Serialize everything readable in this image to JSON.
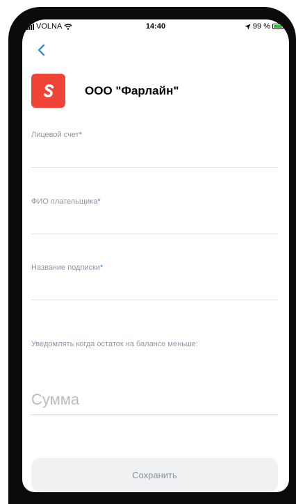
{
  "status_bar": {
    "carrier": "VOLNA",
    "time": "14:40",
    "battery_percent": "99 %",
    "battery_level": 0.99
  },
  "header": {
    "company_name": "ООО \"Фарлайн\"",
    "logo_color": "#f04438"
  },
  "form": {
    "account": {
      "label": "Лицевой счет",
      "required_mark": "*",
      "value": ""
    },
    "payer_name": {
      "label": "ФИО плательщика",
      "required_mark": "*",
      "value": ""
    },
    "subscription_name": {
      "label": "Название подписки",
      "required_mark": "*",
      "value": ""
    },
    "notify_label": "Уведомлять когда остаток на балансе меньше:",
    "amount": {
      "placeholder": "Сумма",
      "value": ""
    }
  },
  "actions": {
    "save_label": "Сохранить"
  },
  "colors": {
    "accent": "#3b8fd6",
    "label_gray": "#8e96a3",
    "button_bg": "#f0f1f3"
  }
}
